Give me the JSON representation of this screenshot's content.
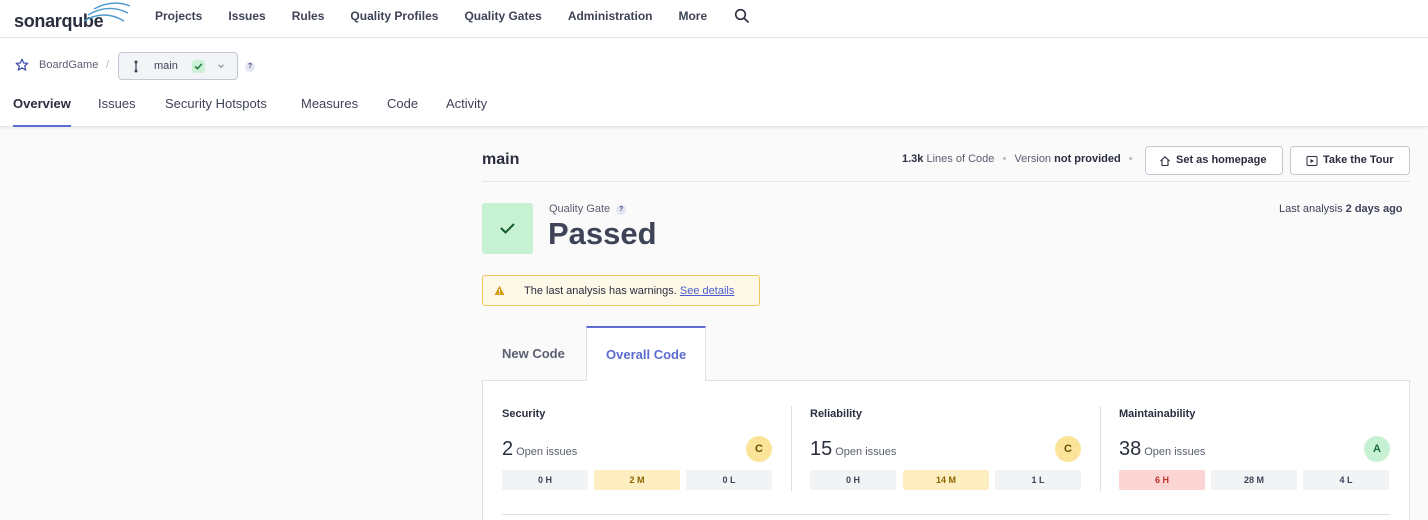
{
  "app": {
    "logo_text": "sonarqube"
  },
  "nav": {
    "items": [
      {
        "label": "Projects"
      },
      {
        "label": "Issues"
      },
      {
        "label": "Rules"
      },
      {
        "label": "Quality Profiles"
      },
      {
        "label": "Quality Gates"
      },
      {
        "label": "Administration"
      },
      {
        "label": "More"
      }
    ],
    "search_icon": "search-icon"
  },
  "project": {
    "name": "BoardGame",
    "separator": "/",
    "branch": "main",
    "help": "?",
    "tabs": [
      {
        "label": "Overview",
        "active": true
      },
      {
        "label": "Issues"
      },
      {
        "label": "Security Hotspots"
      },
      {
        "label": "Measures"
      },
      {
        "label": "Code"
      },
      {
        "label": "Activity"
      }
    ]
  },
  "overview": {
    "title": "main",
    "loc_value": "1.3k",
    "loc_label": "Lines of Code",
    "version_label": "Version",
    "version_value": "not provided",
    "set_homepage_label": "Set as homepage",
    "take_tour_label": "Take the Tour",
    "quality_gate_label": "Quality Gate",
    "quality_gate_help": "?",
    "quality_gate_status": "Passed",
    "last_analysis_label": "Last analysis",
    "last_analysis_value": "2 days ago",
    "warning_text": "The last analysis has warnings.",
    "warning_link": "See details",
    "code_tabs": [
      {
        "label": "New Code"
      },
      {
        "label": "Overall Code",
        "active": true
      }
    ]
  },
  "metrics": [
    {
      "title": "Security",
      "count": "2",
      "count_label": "Open issues",
      "rating": "C",
      "severities": [
        {
          "label": "0 H"
        },
        {
          "label": "2 M"
        },
        {
          "label": "0 L"
        }
      ]
    },
    {
      "title": "Reliability",
      "count": "15",
      "count_label": "Open issues",
      "rating": "C",
      "severities": [
        {
          "label": "0 H"
        },
        {
          "label": "14 M"
        },
        {
          "label": "1 L"
        }
      ]
    },
    {
      "title": "Maintainability",
      "count": "38",
      "count_label": "Open issues",
      "rating": "A",
      "severities": [
        {
          "label": "6 H"
        },
        {
          "label": "28 M"
        },
        {
          "label": "4 L"
        }
      ]
    }
  ],
  "colors": {
    "accent": "#5d6cd0",
    "passed_bg": "#c7f1d3",
    "rating_c": "#fbe39a",
    "rating_a": "#c7f1d3",
    "warning_border": "#f0c75b",
    "severity_high": "#fbd4d3"
  }
}
